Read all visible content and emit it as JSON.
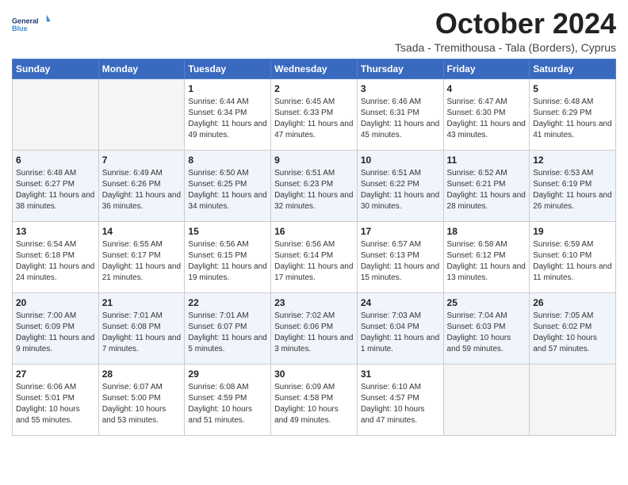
{
  "header": {
    "logo_general": "General",
    "logo_blue": "Blue",
    "month_title": "October 2024",
    "subtitle": "Tsada - Tremithousa - Tala (Borders), Cyprus"
  },
  "days_of_week": [
    "Sunday",
    "Monday",
    "Tuesday",
    "Wednesday",
    "Thursday",
    "Friday",
    "Saturday"
  ],
  "weeks": [
    [
      {
        "day": "",
        "empty": true
      },
      {
        "day": "",
        "empty": true
      },
      {
        "day": "1",
        "sunrise": "6:44 AM",
        "sunset": "6:34 PM",
        "daylight": "11 hours and 49 minutes."
      },
      {
        "day": "2",
        "sunrise": "6:45 AM",
        "sunset": "6:33 PM",
        "daylight": "11 hours and 47 minutes."
      },
      {
        "day": "3",
        "sunrise": "6:46 AM",
        "sunset": "6:31 PM",
        "daylight": "11 hours and 45 minutes."
      },
      {
        "day": "4",
        "sunrise": "6:47 AM",
        "sunset": "6:30 PM",
        "daylight": "11 hours and 43 minutes."
      },
      {
        "day": "5",
        "sunrise": "6:48 AM",
        "sunset": "6:29 PM",
        "daylight": "11 hours and 41 minutes."
      }
    ],
    [
      {
        "day": "6",
        "sunrise": "6:48 AM",
        "sunset": "6:27 PM",
        "daylight": "11 hours and 38 minutes."
      },
      {
        "day": "7",
        "sunrise": "6:49 AM",
        "sunset": "6:26 PM",
        "daylight": "11 hours and 36 minutes."
      },
      {
        "day": "8",
        "sunrise": "6:50 AM",
        "sunset": "6:25 PM",
        "daylight": "11 hours and 34 minutes."
      },
      {
        "day": "9",
        "sunrise": "6:51 AM",
        "sunset": "6:23 PM",
        "daylight": "11 hours and 32 minutes."
      },
      {
        "day": "10",
        "sunrise": "6:51 AM",
        "sunset": "6:22 PM",
        "daylight": "11 hours and 30 minutes."
      },
      {
        "day": "11",
        "sunrise": "6:52 AM",
        "sunset": "6:21 PM",
        "daylight": "11 hours and 28 minutes."
      },
      {
        "day": "12",
        "sunrise": "6:53 AM",
        "sunset": "6:19 PM",
        "daylight": "11 hours and 26 minutes."
      }
    ],
    [
      {
        "day": "13",
        "sunrise": "6:54 AM",
        "sunset": "6:18 PM",
        "daylight": "11 hours and 24 minutes."
      },
      {
        "day": "14",
        "sunrise": "6:55 AM",
        "sunset": "6:17 PM",
        "daylight": "11 hours and 21 minutes."
      },
      {
        "day": "15",
        "sunrise": "6:56 AM",
        "sunset": "6:15 PM",
        "daylight": "11 hours and 19 minutes."
      },
      {
        "day": "16",
        "sunrise": "6:56 AM",
        "sunset": "6:14 PM",
        "daylight": "11 hours and 17 minutes."
      },
      {
        "day": "17",
        "sunrise": "6:57 AM",
        "sunset": "6:13 PM",
        "daylight": "11 hours and 15 minutes."
      },
      {
        "day": "18",
        "sunrise": "6:58 AM",
        "sunset": "6:12 PM",
        "daylight": "11 hours and 13 minutes."
      },
      {
        "day": "19",
        "sunrise": "6:59 AM",
        "sunset": "6:10 PM",
        "daylight": "11 hours and 11 minutes."
      }
    ],
    [
      {
        "day": "20",
        "sunrise": "7:00 AM",
        "sunset": "6:09 PM",
        "daylight": "11 hours and 9 minutes."
      },
      {
        "day": "21",
        "sunrise": "7:01 AM",
        "sunset": "6:08 PM",
        "daylight": "11 hours and 7 minutes."
      },
      {
        "day": "22",
        "sunrise": "7:01 AM",
        "sunset": "6:07 PM",
        "daylight": "11 hours and 5 minutes."
      },
      {
        "day": "23",
        "sunrise": "7:02 AM",
        "sunset": "6:06 PM",
        "daylight": "11 hours and 3 minutes."
      },
      {
        "day": "24",
        "sunrise": "7:03 AM",
        "sunset": "6:04 PM",
        "daylight": "11 hours and 1 minute."
      },
      {
        "day": "25",
        "sunrise": "7:04 AM",
        "sunset": "6:03 PM",
        "daylight": "10 hours and 59 minutes."
      },
      {
        "day": "26",
        "sunrise": "7:05 AM",
        "sunset": "6:02 PM",
        "daylight": "10 hours and 57 minutes."
      }
    ],
    [
      {
        "day": "27",
        "sunrise": "6:06 AM",
        "sunset": "5:01 PM",
        "daylight": "10 hours and 55 minutes."
      },
      {
        "day": "28",
        "sunrise": "6:07 AM",
        "sunset": "5:00 PM",
        "daylight": "10 hours and 53 minutes."
      },
      {
        "day": "29",
        "sunrise": "6:08 AM",
        "sunset": "4:59 PM",
        "daylight": "10 hours and 51 minutes."
      },
      {
        "day": "30",
        "sunrise": "6:09 AM",
        "sunset": "4:58 PM",
        "daylight": "10 hours and 49 minutes."
      },
      {
        "day": "31",
        "sunrise": "6:10 AM",
        "sunset": "4:57 PM",
        "daylight": "10 hours and 47 minutes."
      },
      {
        "day": "",
        "empty": true
      },
      {
        "day": "",
        "empty": true
      }
    ]
  ],
  "labels": {
    "sunrise": "Sunrise:",
    "sunset": "Sunset:",
    "daylight": "Daylight:"
  }
}
